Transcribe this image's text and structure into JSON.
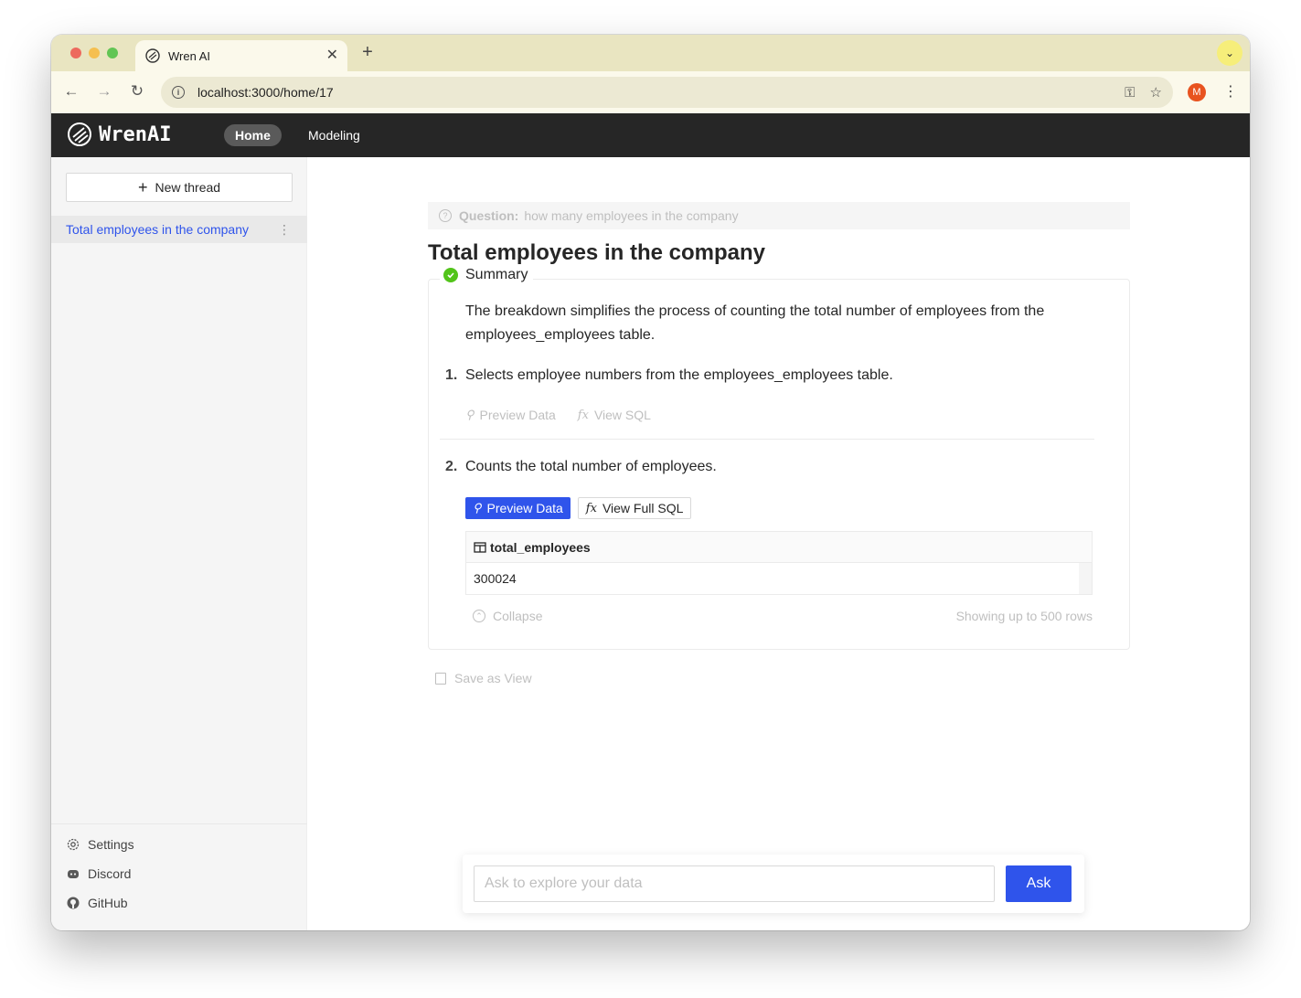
{
  "browser": {
    "tab_title": "Wren AI",
    "url": "localhost:3000/home/17",
    "profile_initial": "M"
  },
  "app": {
    "logo_text": "WrenAI",
    "nav": {
      "home": "Home",
      "modeling": "Modeling"
    }
  },
  "sidebar": {
    "new_thread": "New thread",
    "threads": [
      {
        "label": "Total employees in the company"
      }
    ],
    "footer": {
      "settings": "Settings",
      "discord": "Discord",
      "github": "GitHub"
    }
  },
  "main": {
    "question_label": "Question:",
    "question_text": "how many employees in the company",
    "title": "Total employees in the company",
    "summary_label": "Summary",
    "description": "The breakdown simplifies the process of counting the total number of employees from the employees_employees table.",
    "steps": [
      {
        "num": "1.",
        "text": "Selects employee numbers from the employees_employees table.",
        "preview": "Preview Data",
        "sql": "View SQL"
      },
      {
        "num": "2.",
        "text": "Counts the total number of employees.",
        "preview": "Preview Data",
        "sql": "View Full SQL"
      }
    ],
    "table": {
      "columns": [
        "total_employees"
      ],
      "rows": [
        [
          "300024"
        ]
      ]
    },
    "collapse": "Collapse",
    "rows_note": "Showing up to 500 rows",
    "save_as_view": "Save as View"
  },
  "ask": {
    "placeholder": "Ask to explore your data",
    "button": "Ask"
  },
  "colors": {
    "primary": "#2f54eb",
    "header_bg": "#262626",
    "success": "#52c41a",
    "chrome_bg": "#e9e5c1"
  }
}
